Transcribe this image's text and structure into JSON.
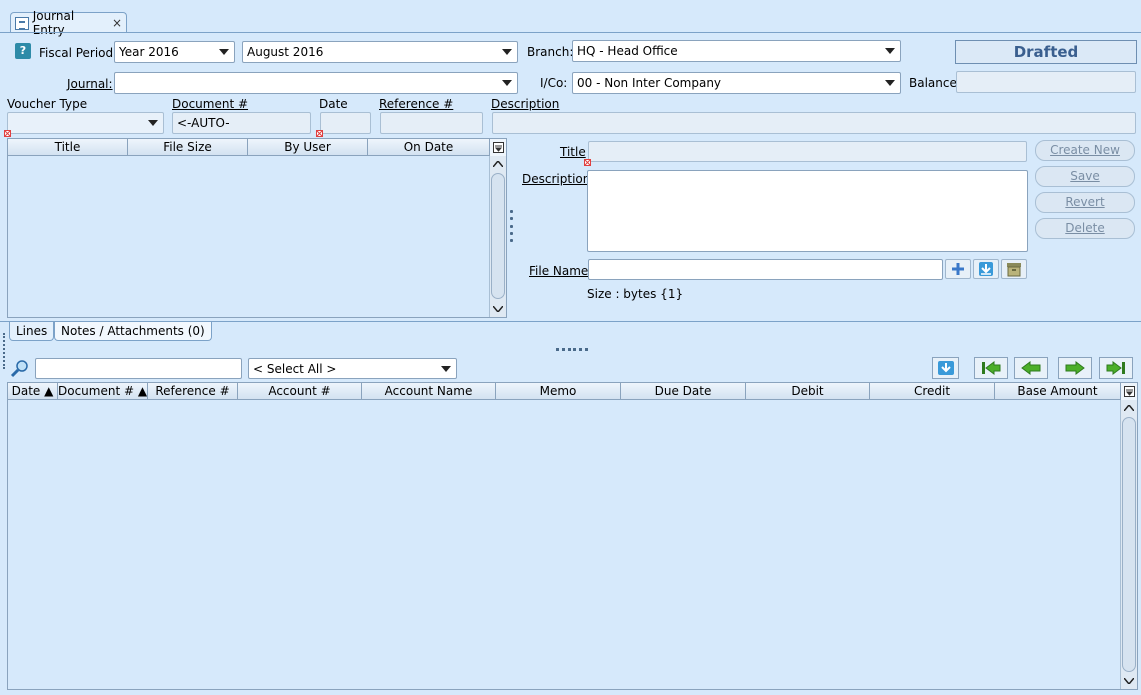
{
  "tab": {
    "title": "Journal Entry",
    "close": "×"
  },
  "header": {
    "help": "?",
    "fiscal_period_label": "Fiscal Period:",
    "fiscal_year": "Year 2016",
    "fiscal_month": "August 2016",
    "branch_label": "Branch:",
    "branch": "HQ - Head Office",
    "status": "Drafted",
    "journal_label": "Journal:",
    "journal": "",
    "ico_label": "I/Co:",
    "ico": "00 - Non Inter Company",
    "balance_label": "Balance",
    "balance": ""
  },
  "voucher": {
    "voucher_type_label": "Voucher Type",
    "voucher_type": "",
    "document_label": "Document #",
    "document": "<-AUTO-GENERATED->",
    "date_label": "Date",
    "date": "",
    "reference_label": "Reference #",
    "reference": "",
    "description_label": "Description",
    "description": ""
  },
  "attachments": {
    "columns": [
      "Title",
      "File Size",
      "By User",
      "On Date"
    ],
    "title_label": "Title",
    "description_label": "Description",
    "file_name_label": "File Name",
    "size_text": "Size :  bytes {1}",
    "buttons": {
      "create_new": "Create New",
      "save": "Save",
      "revert": "Revert",
      "delete": "Delete"
    }
  },
  "lower_tabs": {
    "lines": "Lines",
    "notes": "Notes / Attachments (0)"
  },
  "lines": {
    "search_placeholder": "",
    "select_all": "< Select All >",
    "columns": [
      "Date ▲",
      "Document # ▲",
      "Reference #",
      "Account #",
      "Account Name",
      "Memo",
      "Due Date",
      "Debit",
      "Credit",
      "Base Amount"
    ]
  },
  "icons": {
    "help": "help-icon",
    "search": "search-icon",
    "add": "plus-icon",
    "download": "download-icon",
    "archive": "archive-icon",
    "first": "first-page-icon",
    "prev": "previous-icon",
    "next": "next-icon",
    "last": "last-page-icon",
    "export": "export-icon"
  },
  "colors": {
    "background": "#d6e9fb",
    "status_text": "#3a5f8f",
    "nav_arrow": "#4caf2a",
    "required": "#e04040"
  }
}
